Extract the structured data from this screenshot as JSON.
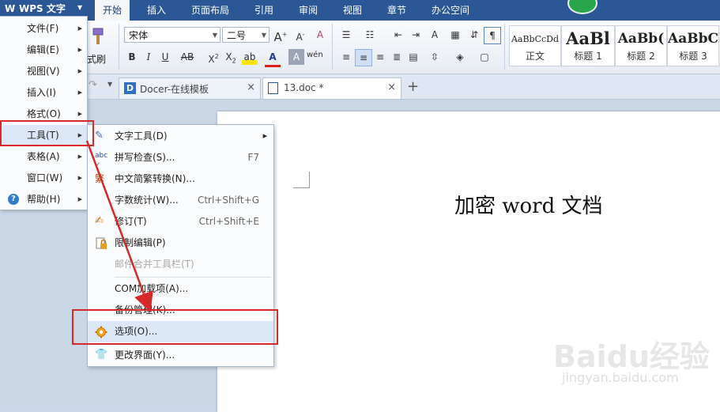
{
  "app": {
    "menu_button": "WPS 文字"
  },
  "ribbon_tabs": [
    "开始",
    "插入",
    "页面布局",
    "引用",
    "审阅",
    "视图",
    "章节",
    "办公空间"
  ],
  "ribbon": {
    "font_name": "宋体",
    "font_size": "二号",
    "format_brush": "式刷",
    "styles": [
      {
        "sample": "AaBbCcDd",
        "name": "正文"
      },
      {
        "sample": "AaBl",
        "name": "标题 1"
      },
      {
        "sample": "AaBb(",
        "name": "标题 2"
      },
      {
        "sample": "AaBbC",
        "name": "标题 3"
      }
    ]
  },
  "doc_tabs": [
    {
      "label": "Docer-在线模板",
      "close": "×"
    },
    {
      "label": "13.doc *",
      "close": "×"
    }
  ],
  "new_tab": "+",
  "main_menu": [
    {
      "label": "文件(F)"
    },
    {
      "label": "编辑(E)"
    },
    {
      "label": "视图(V)"
    },
    {
      "label": "插入(I)"
    },
    {
      "label": "格式(O)"
    },
    {
      "label": "工具(T)"
    },
    {
      "label": "表格(A)"
    },
    {
      "label": "窗口(W)"
    },
    {
      "label": "帮助(H)"
    }
  ],
  "tools_submenu": [
    {
      "label": "文字工具(D)",
      "shortcut": "",
      "icon": "text-tool-icon"
    },
    {
      "label": "拼写检查(S)...",
      "shortcut": "F7",
      "icon": "spellcheck-icon"
    },
    {
      "label": "中文简繁转换(N)...",
      "shortcut": "",
      "icon": "convert-icon"
    },
    {
      "label": "字数统计(W)...",
      "shortcut": "Ctrl+Shift+G",
      "icon": ""
    },
    {
      "label": "修订(T)",
      "shortcut": "Ctrl+Shift+E",
      "icon": "revision-icon"
    },
    {
      "label": "限制编辑(P)",
      "shortcut": "",
      "icon": "lock-icon"
    },
    {
      "label": "邮件合并工具栏(T)",
      "shortcut": "",
      "icon": "",
      "disabled": true
    },
    {
      "label": "COM加载项(A)...",
      "shortcut": "",
      "icon": ""
    },
    {
      "label": "备份管理(K)...",
      "shortcut": "",
      "icon": ""
    },
    {
      "label": "选项(O)...",
      "shortcut": "",
      "icon": "gear-icon"
    },
    {
      "label": "更改界面(Y)...",
      "shortcut": "",
      "icon": "shirt-icon"
    }
  ],
  "document": {
    "title": "加密 word 文档"
  },
  "watermark": {
    "logo": "Baidu经验",
    "url": "jingyan.baidu.com"
  },
  "colors": {
    "title_bar": "#2b5797",
    "highlight": "#dce8f7",
    "annotation_red": "#d9282a"
  }
}
